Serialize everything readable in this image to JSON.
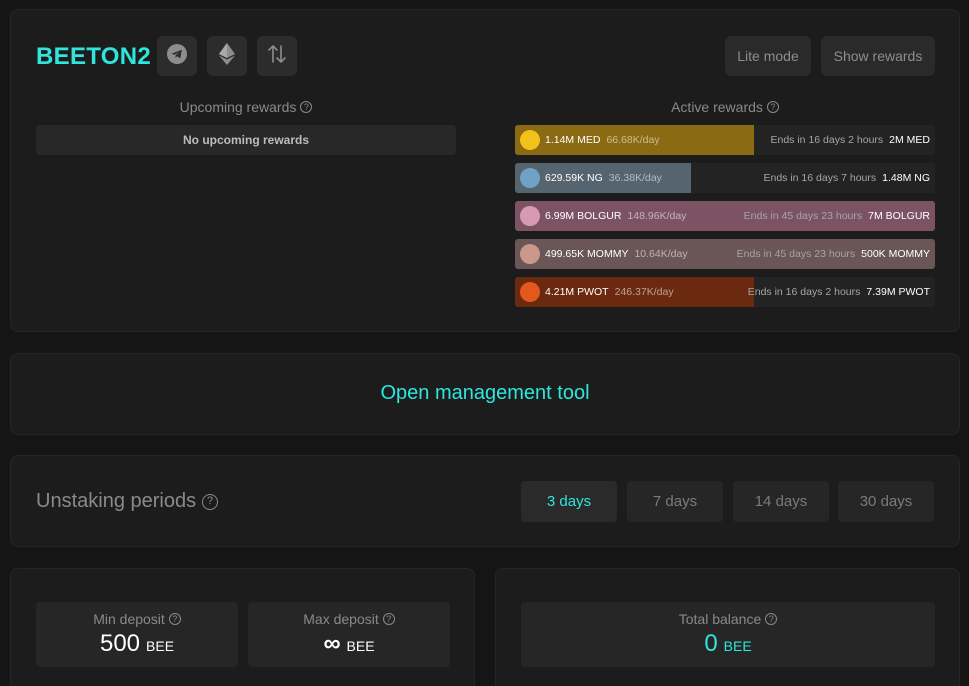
{
  "pool": {
    "title": "BEETON2",
    "icons": [
      "telegram-icon",
      "ethereum-icon",
      "swap-arrows-icon"
    ],
    "lite_mode_label": "Lite mode",
    "show_rewards_label": "Show rewards"
  },
  "upcoming": {
    "label": "Upcoming rewards",
    "help": "?",
    "empty_text": "No upcoming rewards"
  },
  "active": {
    "label": "Active rewards",
    "help": "?",
    "rows": [
      {
        "amount": "1.14M MED",
        "rate": "66.68K/day",
        "ends": "Ends in 16 days 2 hours",
        "total": "2M MED",
        "progress_pct": 57,
        "color": "#8a6a12",
        "avatar_color": "#f2c21b"
      },
      {
        "amount": "629.59K NG",
        "rate": "36.38K/day",
        "ends": "Ends in 16 days 7 hours",
        "total": "1.48M NG",
        "progress_pct": 42,
        "color": "#56646f",
        "avatar_color": "#6fa2c6"
      },
      {
        "amount": "6.99M BOLGUR",
        "rate": "148.96K/day",
        "ends": "Ends in 45 days 23 hours",
        "total": "7M BOLGUR",
        "progress_pct": 100,
        "color": "#7c5363",
        "avatar_color": "#d89ab3"
      },
      {
        "amount": "499.65K MOMMY",
        "rate": "10.64K/day",
        "ends": "Ends in 45 days 23 hours",
        "total": "500K MOMMY",
        "progress_pct": 100,
        "color": "#6a5557",
        "avatar_color": "#c99a8c"
      },
      {
        "amount": "4.21M PWOT",
        "rate": "246.37K/day",
        "ends": "Ends in 16 days 2 hours",
        "total": "7.39M PWOT",
        "progress_pct": 57,
        "color": "#6b2a10",
        "avatar_color": "#e2581e"
      }
    ]
  },
  "management": {
    "link_label": "Open management tool"
  },
  "unstaking": {
    "title": "Unstaking periods",
    "help": "?",
    "periods": [
      "3 days",
      "7 days",
      "14 days",
      "30 days"
    ],
    "selected": "3 days"
  },
  "deposit": {
    "min_label": "Min deposit",
    "min_value": "500",
    "min_unit": "BEE",
    "max_label": "Max deposit",
    "max_value": "∞",
    "max_unit": "BEE",
    "help": "?"
  },
  "balance": {
    "label": "Total balance",
    "value": "0",
    "unit": "BEE",
    "help": "?"
  },
  "colors": {
    "accent": "#2ee6dd",
    "background": "#151515",
    "card": "#1c1c1c"
  }
}
